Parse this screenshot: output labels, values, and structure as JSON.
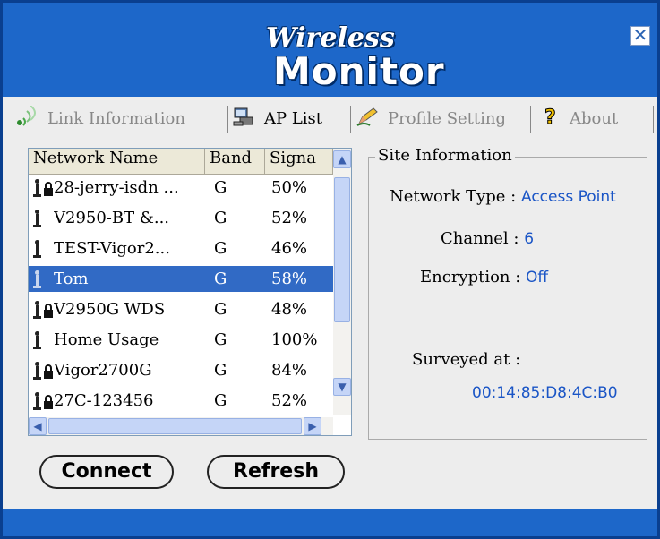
{
  "title": {
    "line1": "Wireless",
    "line2": "Monitor",
    "close": "✕"
  },
  "tabs": [
    {
      "label": "Link Information",
      "icon": "signal-icon"
    },
    {
      "label": "AP List",
      "icon": "network-computer-icon"
    },
    {
      "label": "Profile Setting",
      "icon": "pencil-icon"
    },
    {
      "label": "About",
      "icon": "question-icon"
    }
  ],
  "list": {
    "columns": [
      "Network Name",
      "Band",
      "Signa"
    ],
    "rows": [
      {
        "name": "28-jerry-isdn ...",
        "band": "G",
        "signal": "50%",
        "locked": true
      },
      {
        "name": "V2950-BT &...",
        "band": "G",
        "signal": "52%",
        "locked": false
      },
      {
        "name": "TEST-Vigor2...",
        "band": "G",
        "signal": "46%",
        "locked": false
      },
      {
        "name": "Tom",
        "band": "G",
        "signal": "58%",
        "locked": false,
        "selected": true
      },
      {
        "name": "V2950G WDS",
        "band": "G",
        "signal": "48%",
        "locked": true
      },
      {
        "name": "Home Usage",
        "band": "G",
        "signal": "100%",
        "locked": false
      },
      {
        "name": "Vigor2700G",
        "band": "G",
        "signal": "84%",
        "locked": true
      },
      {
        "name": "27C-123456",
        "band": "G",
        "signal": "52%",
        "locked": true
      }
    ],
    "scroll_up": "▲",
    "scroll_down": "▼",
    "scroll_left": "◀",
    "scroll_right": "▶"
  },
  "site": {
    "title": "Site Information",
    "network_type_label": "Network Type : ",
    "network_type_value": "Access Point",
    "channel_label": "Channel : ",
    "channel_value": "6",
    "encryption_label": "Encryption : ",
    "encryption_value": "Off",
    "surveyed_label": "Surveyed at :",
    "surveyed_value": "00:14:85:D8:4C:B0"
  },
  "buttons": {
    "connect": "Connect",
    "refresh": "Refresh"
  },
  "colors": {
    "window_blue": "#1d67c9",
    "selection": "#316ac5",
    "value_blue": "#1a55c6"
  }
}
